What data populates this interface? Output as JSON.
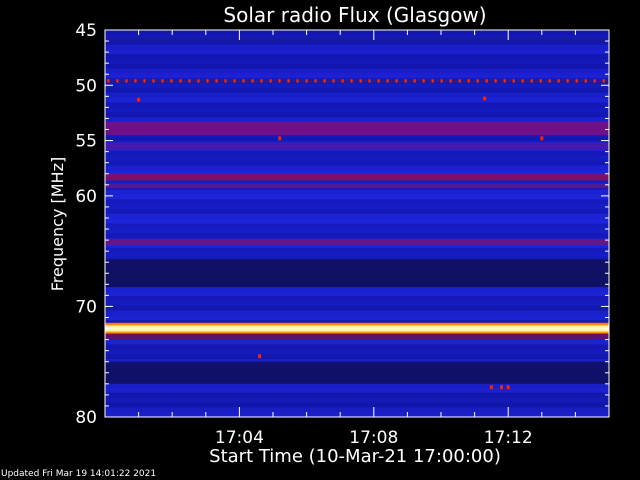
{
  "chart_data": {
    "type": "heatmap",
    "title": "Solar radio Flux (Glasgow)",
    "xlabel": "Start Time (10-Mar-21 17:00:00)",
    "ylabel": "Frequency [MHz]",
    "xlim_minutes": [
      0,
      15
    ],
    "ylim": [
      45,
      80
    ],
    "y_reversed": true,
    "x_ticks": [
      {
        "minute": 4,
        "label": "17:04"
      },
      {
        "minute": 8,
        "label": "17:08"
      },
      {
        "minute": 12,
        "label": "17:12"
      }
    ],
    "y_ticks": [
      {
        "value": 45,
        "label": "45"
      },
      {
        "value": 50,
        "label": "50"
      },
      {
        "value": 55,
        "label": "55"
      },
      {
        "value": 60,
        "label": "60"
      },
      {
        "value": 70,
        "label": "70"
      },
      {
        "value": 80,
        "label": "80"
      }
    ],
    "background_intensity": "low (blue)",
    "bands": [
      {
        "freq_mhz": 45.9,
        "width_mhz": 0.4,
        "level": "low",
        "color": "#1a1aa0"
      },
      {
        "freq_mhz": 49.6,
        "width_mhz": 0.3,
        "level": "pulsed",
        "color": "#ff2a00"
      },
      {
        "freq_mhz": 53.9,
        "width_mhz": 1.2,
        "level": "medium",
        "color": "#7a1080"
      },
      {
        "freq_mhz": 55.5,
        "width_mhz": 0.6,
        "level": "medium-low",
        "color": "#4a1aa8"
      },
      {
        "freq_mhz": 58.3,
        "width_mhz": 0.6,
        "level": "medium",
        "color": "#8a1060"
      },
      {
        "freq_mhz": 59.1,
        "width_mhz": 0.4,
        "level": "medium-low",
        "color": "#5a1a90"
      },
      {
        "freq_mhz": 64.2,
        "width_mhz": 0.5,
        "level": "medium",
        "color": "#6a1580"
      },
      {
        "freq_mhz": 67.0,
        "width_mhz": 2.5,
        "level": "low",
        "color": "#10105a"
      },
      {
        "freq_mhz": 72.0,
        "width_mhz": 0.5,
        "level": "very high",
        "color": "#fff8c0"
      },
      {
        "freq_mhz": 72.7,
        "width_mhz": 0.5,
        "level": "medium",
        "color": "#6a1060"
      },
      {
        "freq_mhz": 76.0,
        "width_mhz": 2.0,
        "level": "low",
        "color": "#101060"
      }
    ],
    "spots": [
      {
        "minute": 1.0,
        "freq_mhz": 51.3
      },
      {
        "minute": 5.2,
        "freq_mhz": 54.8
      },
      {
        "minute": 11.3,
        "freq_mhz": 51.2
      },
      {
        "minute": 13.0,
        "freq_mhz": 54.8
      },
      {
        "minute": 4.6,
        "freq_mhz": 74.5
      },
      {
        "minute": 11.5,
        "freq_mhz": 77.3
      },
      {
        "minute": 11.8,
        "freq_mhz": 77.3
      },
      {
        "minute": 12.0,
        "freq_mhz": 77.3
      }
    ]
  },
  "footer": {
    "updated": "Updated Fri Mar 19 14:01:22 2021"
  }
}
